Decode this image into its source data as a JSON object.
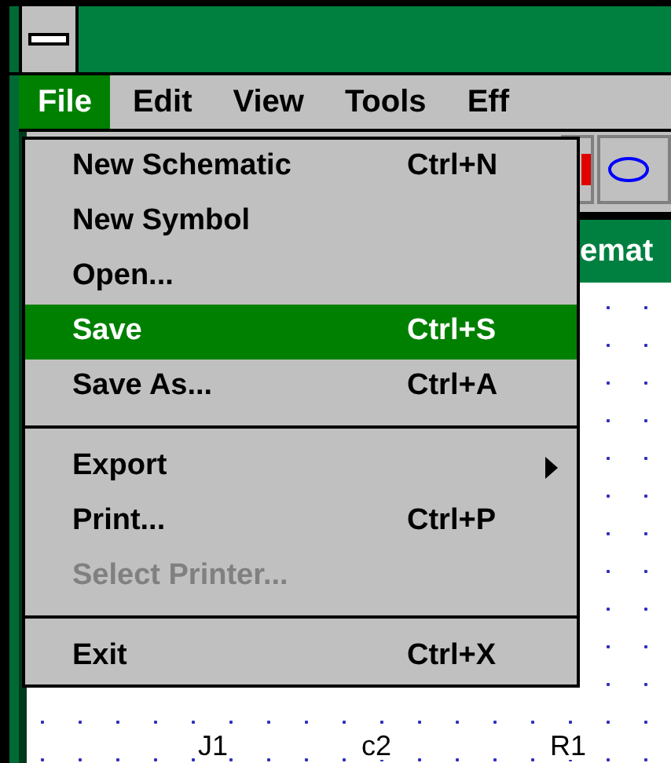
{
  "menu_bar": [
    {
      "label": "File",
      "selected": true
    },
    {
      "label": "Edit",
      "selected": false
    },
    {
      "label": "View",
      "selected": false
    },
    {
      "label": "Tools",
      "selected": false
    },
    {
      "label": "Eff",
      "selected": false
    }
  ],
  "file_menu": {
    "items": [
      {
        "kind": "item",
        "label": "New Schematic",
        "shortcut": "Ctrl+N",
        "selected": false,
        "disabled": false
      },
      {
        "kind": "item",
        "label": "New Symbol",
        "selected": false,
        "disabled": false
      },
      {
        "kind": "item",
        "label": "Open...",
        "selected": false,
        "disabled": false
      },
      {
        "kind": "item",
        "label": "Save",
        "shortcut": "Ctrl+S",
        "selected": true,
        "disabled": false
      },
      {
        "kind": "item",
        "label": "Save As...",
        "shortcut": "Ctrl+A",
        "selected": false,
        "disabled": false
      },
      {
        "kind": "separator"
      },
      {
        "kind": "item",
        "label": "Export",
        "submenu": true,
        "selected": false,
        "disabled": false
      },
      {
        "kind": "item",
        "label": "Print...",
        "shortcut": "Ctrl+P",
        "selected": false,
        "disabled": false
      },
      {
        "kind": "item",
        "label": "Select Printer...",
        "selected": false,
        "disabled": true
      },
      {
        "kind": "separator"
      },
      {
        "kind": "item",
        "label": "Exit",
        "shortcut": "Ctrl+X",
        "selected": false,
        "disabled": false
      }
    ]
  },
  "document_window": {
    "title": "emat"
  },
  "canvas": {
    "labels": [
      "J1",
      "c2",
      "R1"
    ]
  }
}
